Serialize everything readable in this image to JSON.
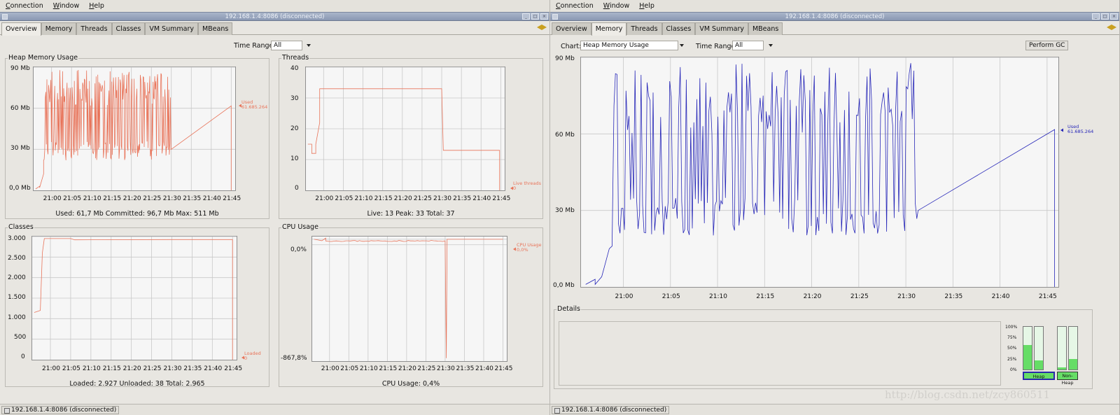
{
  "menus": {
    "connection": "C",
    "connection_rest": "onnection",
    "window": "W",
    "window_rest": "indow",
    "help": "H",
    "help_rest": "elp"
  },
  "window_title": "192.168.1.4:8086 (disconnected)",
  "tabs": [
    "Overview",
    "Memory",
    "Threads",
    "Classes",
    "VM Summary",
    "MBeans"
  ],
  "left": {
    "active_tab": "Overview",
    "time_range_label": "Time Range:",
    "time_range_value": "All",
    "heap": {
      "title": "Heap Memory Usage",
      "yticks": [
        "90 Mb",
        "60 Mb",
        "30 Mb",
        "0,0 Mb"
      ],
      "xticks": [
        "21:00",
        "21:05",
        "21:10",
        "21:15",
        "21:20",
        "21:25",
        "21:30",
        "21:35",
        "21:40",
        "21:45"
      ],
      "legend_name": "Used",
      "legend_value": "61.685.264",
      "stats": "Used: 61,7 Mb    Committed: 96,7 Mb    Max: 511 Mb"
    },
    "threads": {
      "title": "Threads",
      "yticks": [
        "40",
        "30",
        "20",
        "10",
        "0"
      ],
      "xticks": [
        "21:00",
        "21:05",
        "21:10",
        "21:15",
        "21:20",
        "21:25",
        "21:30",
        "21:35",
        "21:40",
        "21:45"
      ],
      "legend_name": "Live threads",
      "legend_value": "0",
      "stats": "Live: 13    Peak: 33    Total: 37"
    },
    "classes": {
      "title": "Classes",
      "yticks": [
        "3.000",
        "2.500",
        "2.000",
        "1.500",
        "1.000",
        "500",
        "0"
      ],
      "xticks": [
        "21:00",
        "21:05",
        "21:10",
        "21:15",
        "21:20",
        "21:25",
        "21:30",
        "21:35",
        "21:40",
        "21:45"
      ],
      "legend_name": "Loaded",
      "legend_value": "0",
      "stats": "Loaded: 2.927    Unloaded: 38    Total: 2.965"
    },
    "cpu": {
      "title": "CPU Usage",
      "yticks": [
        "0,0%",
        "-867,8%"
      ],
      "xticks": [
        "21:00",
        "21:05",
        "21:10",
        "21:15",
        "21:20",
        "21:25",
        "21:30",
        "21:35",
        "21:40",
        "21:45"
      ],
      "legend_name": "CPU Usage",
      "legend_value": "0,0%",
      "stats": "CPU Usage: 0,4%"
    }
  },
  "right": {
    "active_tab": "Memory",
    "chart_label": "Chart:",
    "chart_value": "Heap Memory Usage",
    "time_range_label": "Time Range:",
    "time_range_value": "All",
    "perform_gc": "Perform GC",
    "yticks": [
      "90 Mb",
      "60 Mb",
      "30 Mb",
      "0,0 Mb"
    ],
    "xticks": [
      "21:00",
      "21:05",
      "21:10",
      "21:15",
      "21:20",
      "21:25",
      "21:30",
      "21:35",
      "21:40",
      "21:45"
    ],
    "legend_name": "Used",
    "legend_value": "61.685.264",
    "details_title": "Details",
    "gauge_ticks": [
      "100%",
      "75%",
      "50%",
      "25%",
      "0%"
    ],
    "gauge_labels": [
      "Heap",
      "Non-Heap"
    ]
  },
  "status": "192.168.1.4:8086 (disconnected)",
  "watermark": "http://blog.csdn.net/zcy860511",
  "colors": {
    "overview_series": "#e8745a",
    "memory_series": "#2727b8",
    "gauge_fill": "#66dd66"
  },
  "chart_data": [
    {
      "type": "line",
      "title": "Heap Memory Usage",
      "ylabel": "",
      "ylim": [
        0,
        90
      ],
      "unit": "Mb",
      "x": [
        "20:56",
        "20:58",
        "21:00",
        "21:05",
        "21:10",
        "21:15",
        "21:20",
        "21:25",
        "21:30",
        "21:45"
      ],
      "series": [
        {
          "name": "Used",
          "values": [
            2,
            12,
            60,
            55,
            62,
            58,
            63,
            60,
            30,
            61.7
          ]
        }
      ]
    },
    {
      "type": "line",
      "title": "Threads",
      "ylim": [
        0,
        40
      ],
      "x": [
        "20:56",
        "20:57",
        "20:58",
        "21:00",
        "21:10",
        "21:20",
        "21:30",
        "21:31",
        "21:45"
      ],
      "series": [
        {
          "name": "Live threads",
          "values": [
            15,
            12,
            15,
            33,
            33,
            33,
            33,
            13,
            0
          ]
        }
      ]
    },
    {
      "type": "line",
      "title": "Classes",
      "ylim": [
        0,
        3000
      ],
      "x": [
        "20:56",
        "20:58",
        "20:59",
        "21:05",
        "21:30",
        "21:45"
      ],
      "series": [
        {
          "name": "Loaded",
          "values": [
            1150,
            1200,
            2950,
            2930,
            2927,
            0
          ]
        }
      ]
    },
    {
      "type": "line",
      "title": "CPU Usage",
      "ylim": [
        -867.8,
        0
      ],
      "x": [
        "20:56",
        "21:00",
        "21:29",
        "21:30",
        "21:45"
      ],
      "series": [
        {
          "name": "CPU Usage",
          "values": [
            0,
            0,
            0,
            -867.8,
            0
          ]
        }
      ]
    },
    {
      "type": "line",
      "title": "Heap Memory Usage",
      "ylim": [
        0,
        90
      ],
      "unit": "Mb",
      "x": [
        "20:56",
        "20:58",
        "21:00",
        "21:10",
        "21:20",
        "21:30",
        "21:31",
        "21:45",
        "21:46"
      ],
      "series": [
        {
          "name": "Used",
          "values": [
            1,
            15,
            60,
            58,
            62,
            60,
            30,
            61.7,
            0
          ]
        }
      ]
    },
    {
      "type": "bar",
      "title": "",
      "categories": [
        "Heap",
        "Heap",
        "Non-Heap",
        "Non-Heap"
      ],
      "ylim": [
        0,
        100
      ],
      "series": [
        {
          "name": "",
          "values": [
            57,
            22,
            5,
            25
          ]
        }
      ]
    }
  ]
}
